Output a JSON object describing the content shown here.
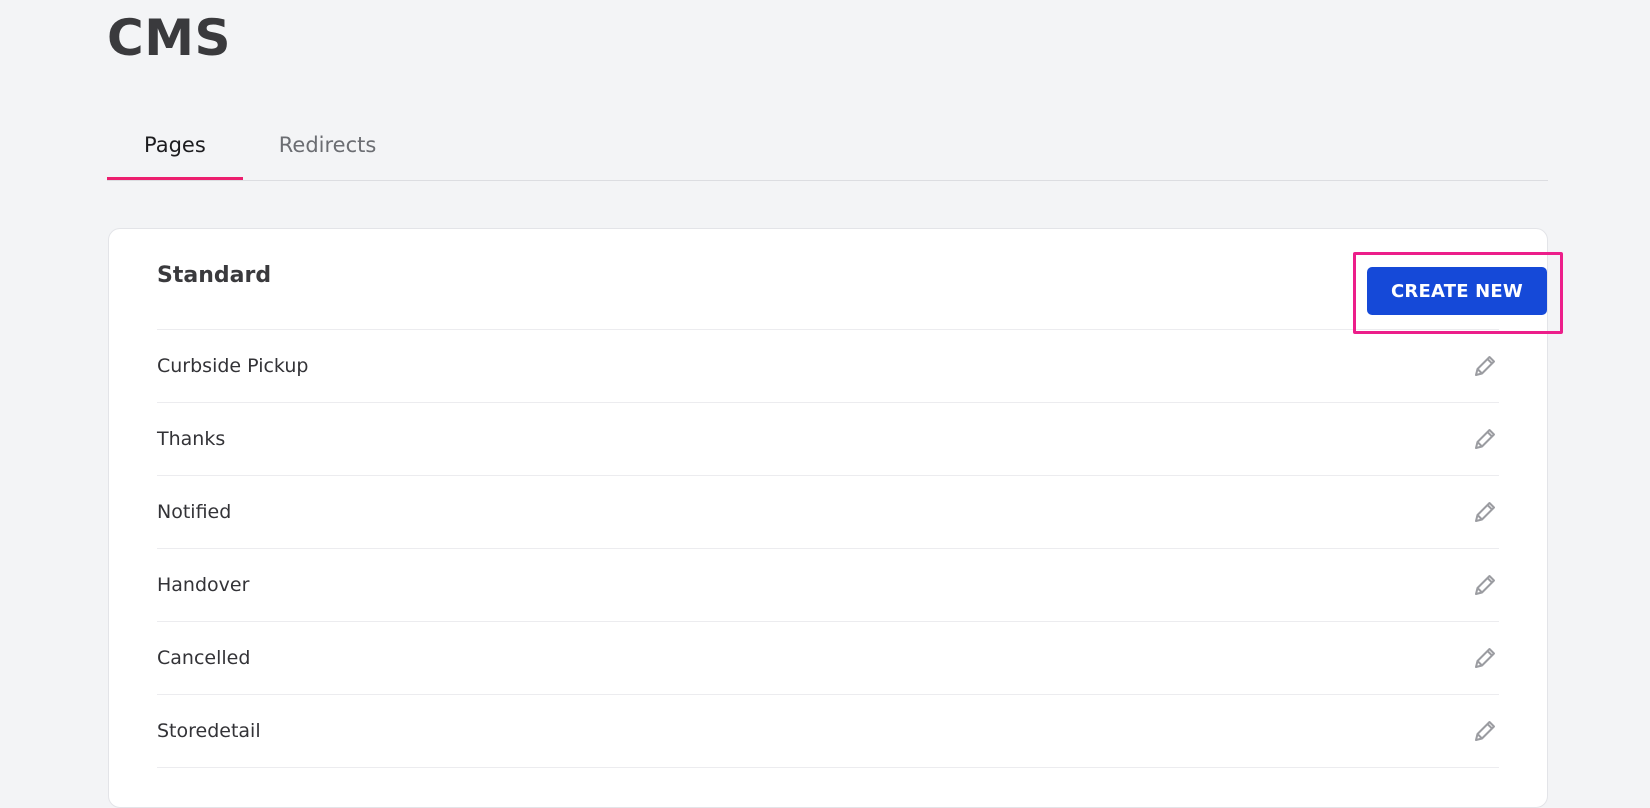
{
  "header": {
    "title": "CMS"
  },
  "tabs": [
    {
      "label": "Pages",
      "active": true
    },
    {
      "label": "Redirects",
      "active": false
    }
  ],
  "section": {
    "title": "Standard",
    "create_label": "CREATE NEW",
    "items": [
      {
        "label": "Curbside Pickup",
        "icon": "pencil-icon"
      },
      {
        "label": "Thanks",
        "icon": "pencil-icon"
      },
      {
        "label": "Notified",
        "icon": "pencil-icon"
      },
      {
        "label": "Handover",
        "icon": "pencil-icon"
      },
      {
        "label": "Cancelled",
        "icon": "pencil-icon"
      },
      {
        "label": "Storedetail",
        "icon": "pencil-icon"
      }
    ]
  },
  "colors": {
    "accent": "#ec1e6e",
    "primary_button": "#1549d8",
    "highlight": "#ec1e8a",
    "background": "#f3f4f6"
  }
}
